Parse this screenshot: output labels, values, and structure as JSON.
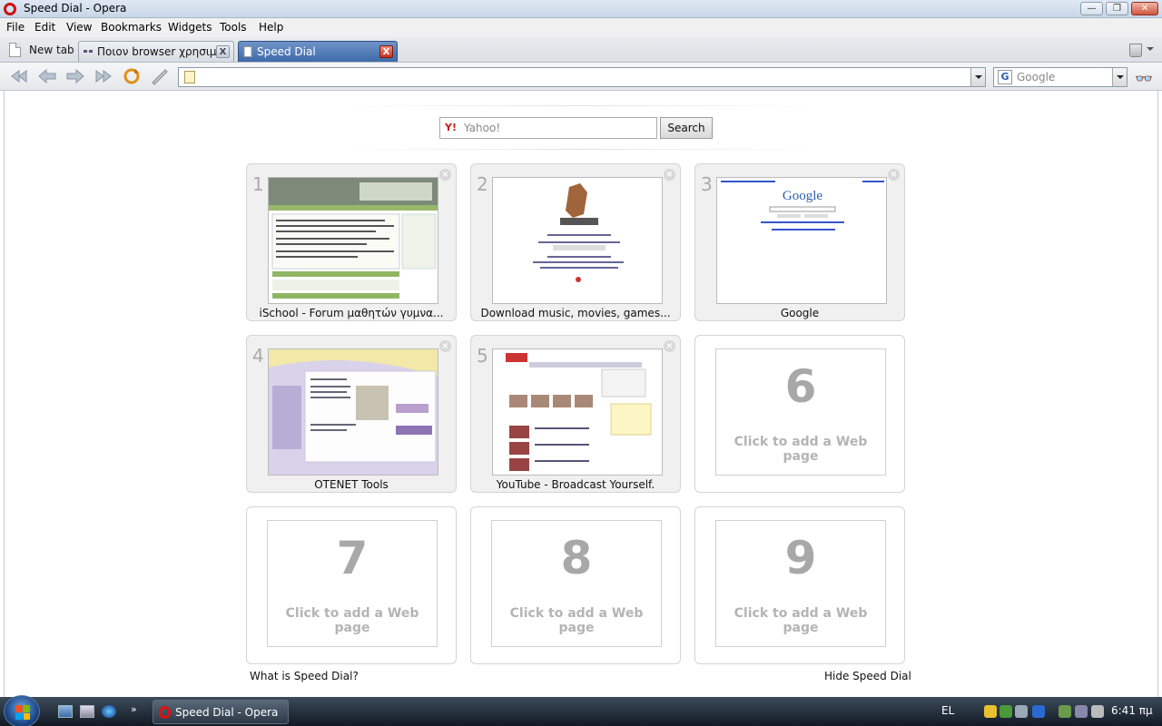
{
  "window": {
    "title": "Speed Dial - Opera"
  },
  "menu": [
    "File",
    "Edit",
    "View",
    "Bookmarks",
    "Widgets",
    "Tools",
    "Help"
  ],
  "tabs": {
    "new_tab_label": "New tab",
    "items": [
      {
        "label": "Ποιον browser χρησιμ...",
        "active": false
      },
      {
        "label": "Speed Dial",
        "active": true
      }
    ]
  },
  "address": {
    "url": "",
    "search_engine": "Google"
  },
  "yahoo_search": {
    "placeholder": "Yahoo!",
    "button": "Search"
  },
  "speed_dial": [
    {
      "num": "1",
      "caption": "iSchool - Forum μαθητών γυμνα...",
      "filled": true
    },
    {
      "num": "2",
      "caption": "Download music, movies, games...",
      "filled": true
    },
    {
      "num": "3",
      "caption": "Google",
      "filled": true
    },
    {
      "num": "4",
      "caption": "OTENET Tools",
      "filled": true
    },
    {
      "num": "5",
      "caption": "YouTube - Broadcast Yourself.",
      "filled": true
    },
    {
      "num": "6",
      "caption": "Click to add a Web page",
      "filled": false
    },
    {
      "num": "7",
      "caption": "Click to add a Web page",
      "filled": false
    },
    {
      "num": "8",
      "caption": "Click to add a Web page",
      "filled": false
    },
    {
      "num": "9",
      "caption": "Click to add a Web page",
      "filled": false
    }
  ],
  "footer": {
    "what_is": "What is Speed Dial?",
    "hide": "Hide Speed Dial"
  },
  "taskbar": {
    "task_label": "Speed Dial - Opera",
    "language": "EL",
    "clock": "6:41 πμ"
  },
  "colors": {
    "accent_tab": "#3e6aa9",
    "opera_red": "#cc1111"
  }
}
